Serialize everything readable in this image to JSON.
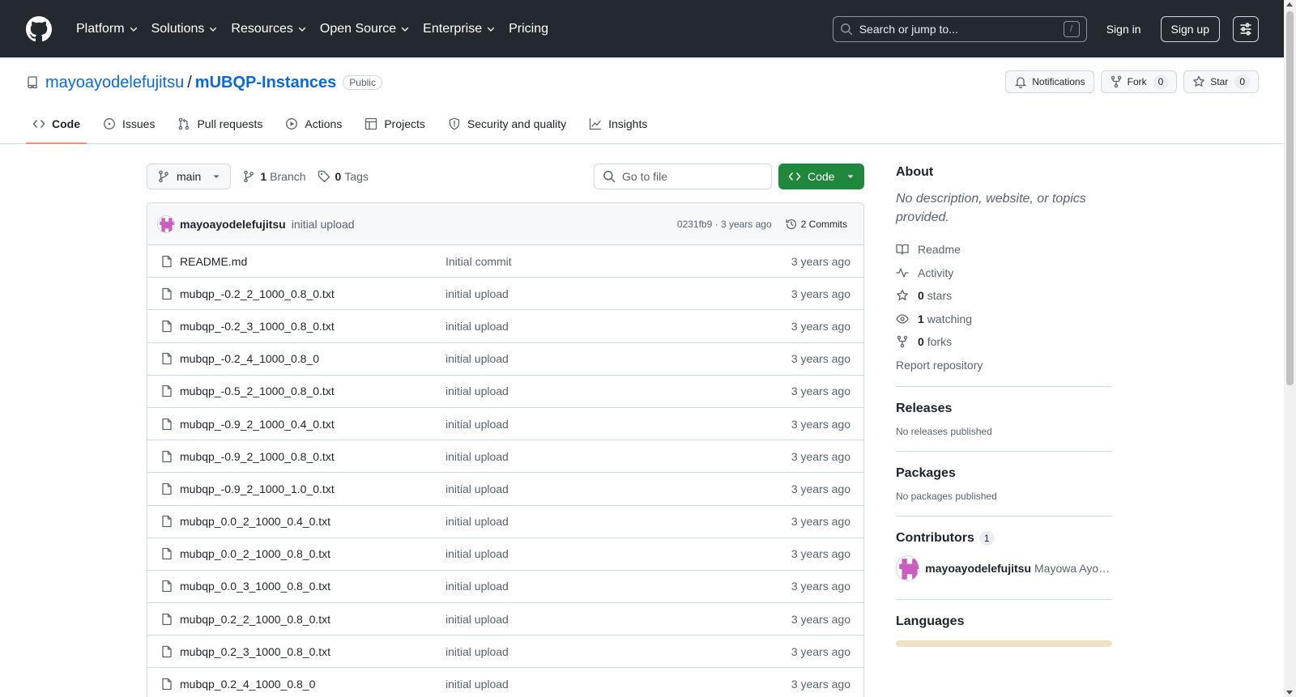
{
  "header": {
    "nav": [
      {
        "label": "Platform",
        "dropdown": true
      },
      {
        "label": "Solutions",
        "dropdown": true
      },
      {
        "label": "Resources",
        "dropdown": true
      },
      {
        "label": "Open Source",
        "dropdown": true
      },
      {
        "label": "Enterprise",
        "dropdown": true
      },
      {
        "label": "Pricing",
        "dropdown": false
      }
    ],
    "search_placeholder": "Search or jump to...",
    "search_key": "/",
    "signin": "Sign in",
    "signup": "Sign up"
  },
  "repo": {
    "owner": "mayoayodelefujitsu",
    "separator": "/",
    "name": "mUBQP-Instances",
    "visibility": "Public",
    "actions": {
      "notifications": "Notifications",
      "fork": "Fork",
      "fork_count": "0",
      "star": "Star",
      "star_count": "0"
    },
    "tabs": [
      {
        "label": "Code",
        "icon": "code-icon",
        "active": true
      },
      {
        "label": "Issues",
        "icon": "issue-icon",
        "active": false
      },
      {
        "label": "Pull requests",
        "icon": "pull-request-icon",
        "active": false
      },
      {
        "label": "Actions",
        "icon": "play-icon",
        "active": false
      },
      {
        "label": "Projects",
        "icon": "table-icon",
        "active": false
      },
      {
        "label": "Security and quality",
        "icon": "shield-icon",
        "active": false
      },
      {
        "label": "Insights",
        "icon": "graph-icon",
        "active": false
      }
    ]
  },
  "toolbar": {
    "branch": "main",
    "branch_count": "1",
    "branch_label": "Branch",
    "tag_count": "0",
    "tag_label": "Tags",
    "goto_placeholder": "Go to file",
    "code_label": "Code"
  },
  "commit": {
    "author": "mayoayodelefujitsu",
    "message": "initial upload",
    "sha_age": "0231fb9 · 3 years ago",
    "commits_label": "2 Commits"
  },
  "files": [
    {
      "name": "README.md",
      "message": "Initial commit",
      "age": "3 years ago"
    },
    {
      "name": "mubqp_-0.2_2_1000_0.8_0.txt",
      "message": "initial upload",
      "age": "3 years ago"
    },
    {
      "name": "mubqp_-0.2_3_1000_0.8_0.txt",
      "message": "initial upload",
      "age": "3 years ago"
    },
    {
      "name": "mubqp_-0.2_4_1000_0.8_0",
      "message": "initial upload",
      "age": "3 years ago"
    },
    {
      "name": "mubqp_-0.5_2_1000_0.8_0.txt",
      "message": "initial upload",
      "age": "3 years ago"
    },
    {
      "name": "mubqp_-0.9_2_1000_0.4_0.txt",
      "message": "initial upload",
      "age": "3 years ago"
    },
    {
      "name": "mubqp_-0.9_2_1000_0.8_0.txt",
      "message": "initial upload",
      "age": "3 years ago"
    },
    {
      "name": "mubqp_-0.9_2_1000_1.0_0.txt",
      "message": "initial upload",
      "age": "3 years ago"
    },
    {
      "name": "mubqp_0.0_2_1000_0.4_0.txt",
      "message": "initial upload",
      "age": "3 years ago"
    },
    {
      "name": "mubqp_0.0_2_1000_0.8_0.txt",
      "message": "initial upload",
      "age": "3 years ago"
    },
    {
      "name": "mubqp_0.0_3_1000_0.8_0.txt",
      "message": "initial upload",
      "age": "3 years ago"
    },
    {
      "name": "mubqp_0.2_2_1000_0.8_0.txt",
      "message": "initial upload",
      "age": "3 years ago"
    },
    {
      "name": "mubqp_0.2_3_1000_0.8_0.txt",
      "message": "initial upload",
      "age": "3 years ago"
    },
    {
      "name": "mubqp_0.2_4_1000_0.8_0",
      "message": "initial upload",
      "age": "3 years ago"
    }
  ],
  "sidebar": {
    "about_title": "About",
    "about_desc": "No description, website, or topics provided.",
    "readme": "Readme",
    "activity": "Activity",
    "stars_count": "0",
    "stars_label": "stars",
    "watching_count": "1",
    "watching_label": "watching",
    "forks_count": "0",
    "forks_label": "forks",
    "report": "Report repository",
    "releases_title": "Releases",
    "releases_empty": "No releases published",
    "packages_title": "Packages",
    "packages_empty": "No packages published",
    "contributors_title": "Contributors",
    "contributors_count": "1",
    "contributor_login": "mayoayodelefujitsu",
    "contributor_name": "Mayowa Ayodele",
    "languages_title": "Languages",
    "language_color": "#ede2c4"
  },
  "colors": {
    "header_bg": "#24292f",
    "link": "#0969da",
    "code_button": "#1f883d",
    "active_tab_underline": "#fd8c73",
    "identicon": "#c85fc0"
  }
}
